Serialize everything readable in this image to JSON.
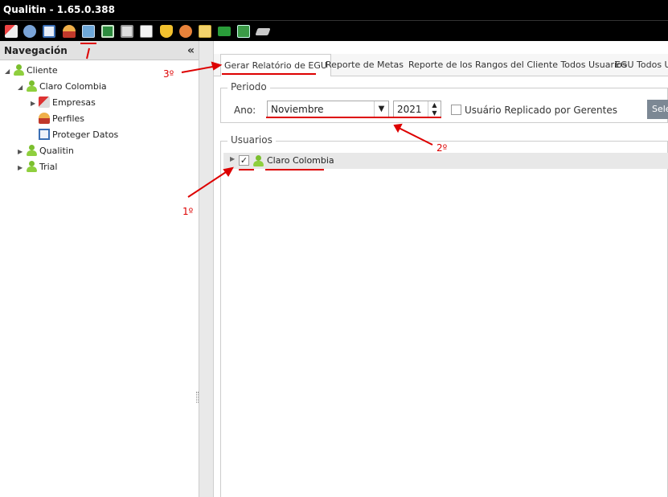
{
  "window": {
    "title": "Qualitin - 1.65.0.388"
  },
  "toolbar": {
    "icons": [
      "tools-icon",
      "users-icon",
      "calendar-icon",
      "person-icon",
      "report-icon",
      "excel-icon",
      "print-icon",
      "book-icon",
      "shield-icon",
      "heart-icon",
      "folder-icon",
      "flag-icon",
      "export-icon",
      "eraser-icon"
    ]
  },
  "sidebar": {
    "title": "Navegación",
    "collapse_label": "«",
    "tree": [
      {
        "label": "Cliente"
      },
      {
        "label": "Claro Colombia"
      },
      {
        "label": "Empresas"
      },
      {
        "label": "Perfiles"
      },
      {
        "label": "Proteger Datos"
      },
      {
        "label": "Qualitin"
      },
      {
        "label": "Trial"
      }
    ]
  },
  "tabs": [
    {
      "label": "Gerar Relatório de EGU"
    },
    {
      "label": "Reporte de Metas"
    },
    {
      "label": "Reporte de los Rangos del Cliente Todos Usuarios"
    },
    {
      "label": "EGU Todos Us"
    }
  ],
  "periodo": {
    "legend": "Periodo",
    "ano_label": "Ano:",
    "month_value": "Noviembre",
    "year_value": "2021",
    "replicado_label": "Usuário Replicado por Gerentes",
    "select_button": "Sele"
  },
  "usuarios": {
    "legend": "Usuarios",
    "rows": [
      {
        "label": "Claro Colombia",
        "checked": "✓"
      }
    ]
  },
  "annotations": {
    "first": "1º",
    "second": "2º",
    "third": "3º"
  },
  "colors": {
    "accent": "#d00000",
    "user_green": "#7bbf2e"
  }
}
